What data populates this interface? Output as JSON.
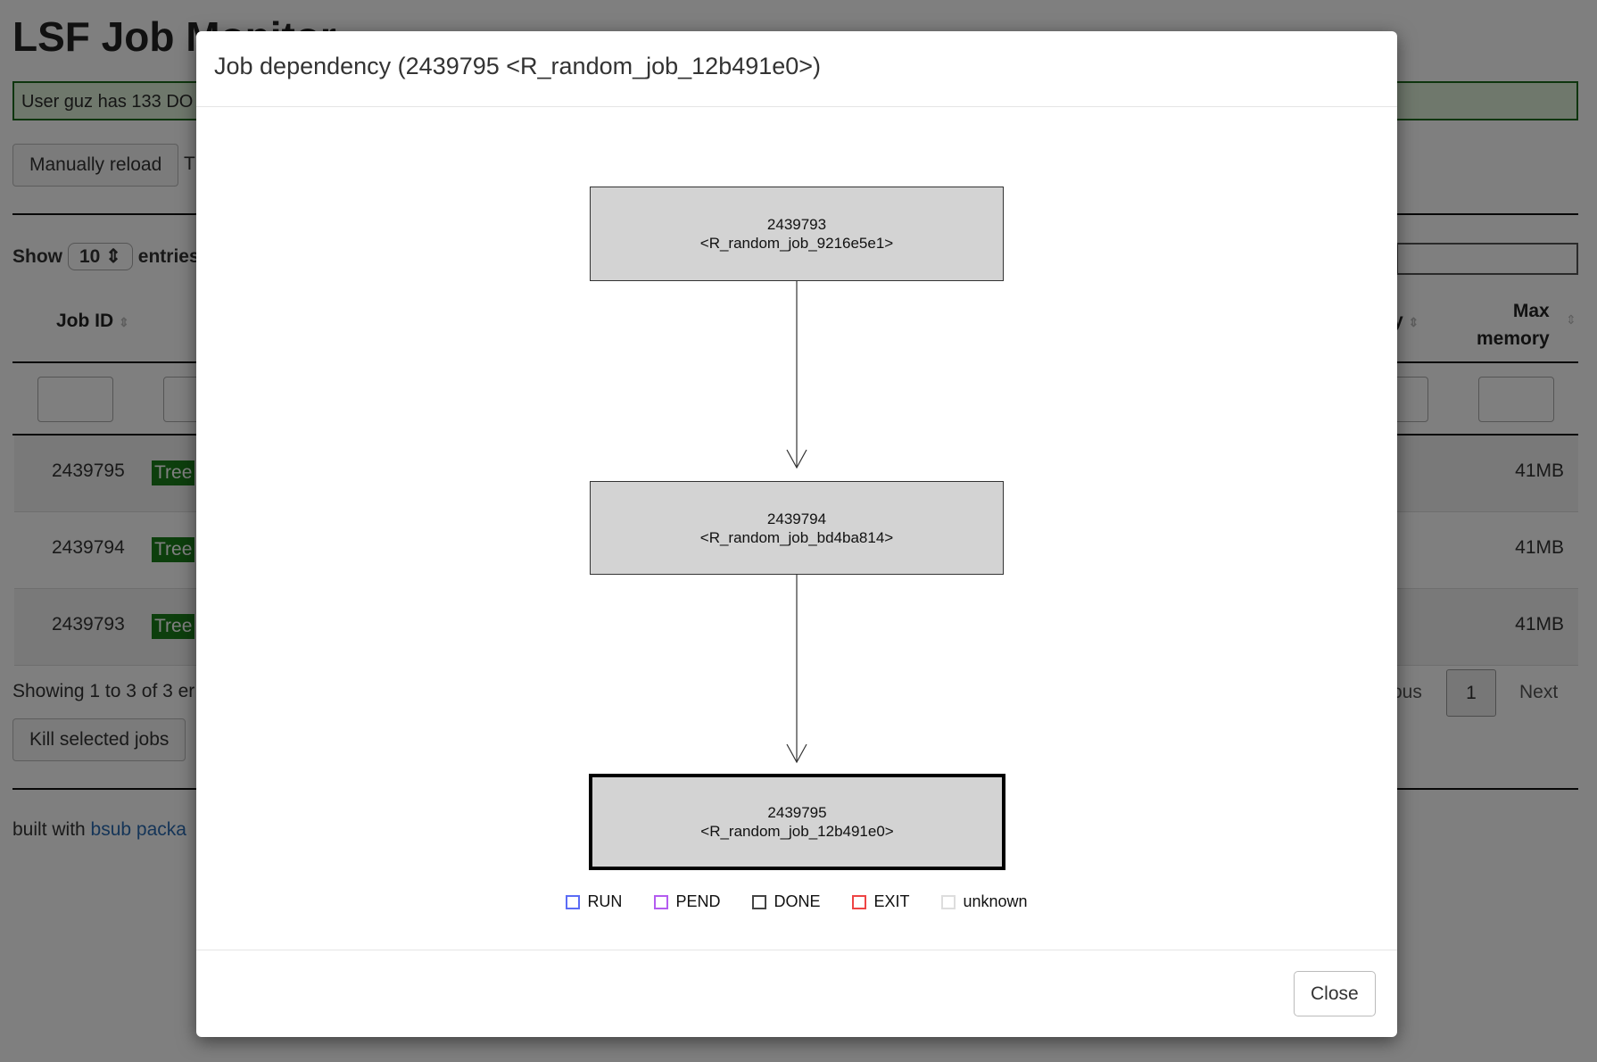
{
  "page": {
    "title": "LSF Job Monitor",
    "alert": "User guz has 133 DO",
    "reload_button": "Manually reload",
    "reload_trailing": "T",
    "show_label": "Show",
    "entries_value": "10",
    "entries_label": "entries",
    "columns": {
      "job_id": "Job ID",
      "memory": "ory",
      "max_memory_line1": "Max",
      "max_memory_line2": "memory"
    },
    "rows": [
      {
        "job_id": "2439795",
        "tree": "Tree",
        "max_memory": "41MB"
      },
      {
        "job_id": "2439794",
        "tree": "Tree",
        "max_memory": "41MB"
      },
      {
        "job_id": "2439793",
        "tree": "Tree",
        "max_memory": "41MB"
      }
    ],
    "showing": "Showing 1 to 3 of 3 er",
    "previous": "ous",
    "page_number": "1",
    "next": "Next",
    "kill_button": "Kill selected jobs",
    "footer_prefix": "built with",
    "footer_link": "bsub packa"
  },
  "modal": {
    "title": "Job dependency (2439795 <R_random_job_12b491e0>)",
    "nodes": [
      {
        "id": "2439793",
        "name": "<R_random_job_9216e5e1>",
        "current": false
      },
      {
        "id": "2439794",
        "name": "<R_random_job_bd4ba814>",
        "current": false
      },
      {
        "id": "2439795",
        "name": "<R_random_job_12b491e0>",
        "current": true
      }
    ],
    "legend": [
      {
        "label": "RUN",
        "color": "#5b6cf5"
      },
      {
        "label": "PEND",
        "color": "#b45cf0"
      },
      {
        "label": "DONE",
        "color": "#444444"
      },
      {
        "label": "EXIT",
        "color": "#ee4444"
      },
      {
        "label": "unknown",
        "color": "#dddddd"
      }
    ],
    "close_button": "Close"
  }
}
